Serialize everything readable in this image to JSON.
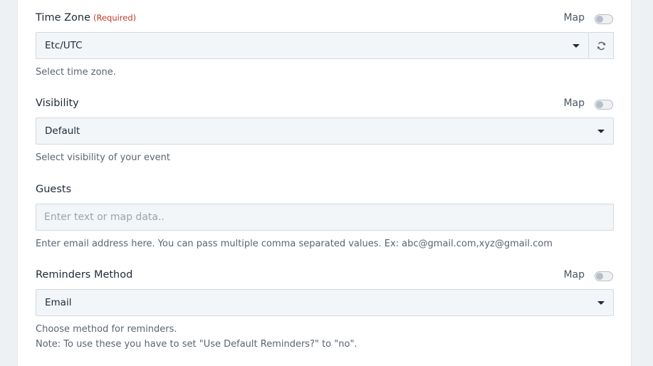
{
  "timezone": {
    "label": "Time Zone",
    "required": "(Required)",
    "map_label": "Map",
    "value": "Etc/UTC",
    "help": "Select time zone."
  },
  "visibility": {
    "label": "Visibility",
    "map_label": "Map",
    "value": "Default",
    "help": "Select visibility of your event"
  },
  "guests": {
    "label": "Guests",
    "placeholder": "Enter text or map data..",
    "value": "",
    "help": "Enter email address here. You can pass multiple comma separated values. Ex: abc@gmail.com,xyz@gmail.com"
  },
  "reminders": {
    "label": "Reminders Method",
    "map_label": "Map",
    "value": "Email",
    "help_line1": "Choose method for reminders.",
    "help_line2": "Note: To use these you have to set \"Use Default Reminders?\" to \"no\"."
  },
  "icons": {
    "refresh": "refresh-icon",
    "caret": "caret-down-icon"
  },
  "colors": {
    "required": "#c0392b",
    "field_bg": "#f3f6f8",
    "border": "#d3d9df"
  }
}
